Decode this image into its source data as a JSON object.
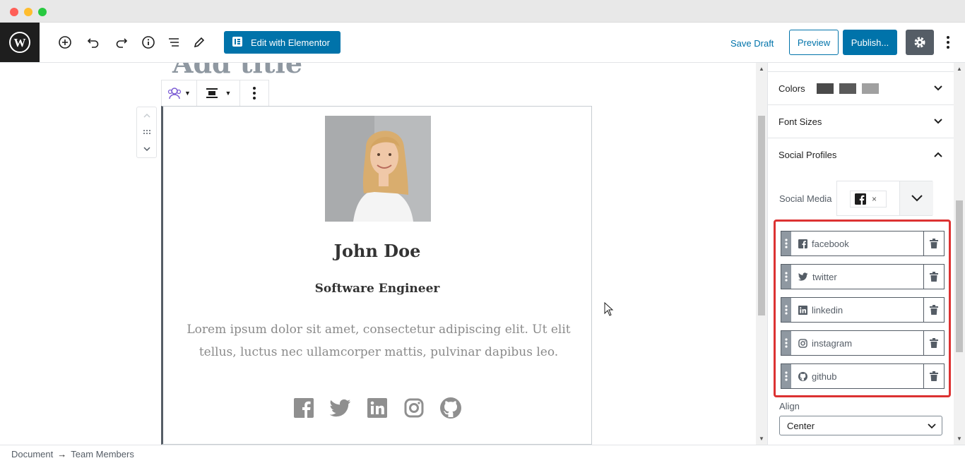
{
  "window": {
    "dots": [
      "#ff5f57",
      "#ffbd2e",
      "#28c940"
    ]
  },
  "toolbar": {
    "icons": [
      "wordpress-logo",
      "plus-icon",
      "undo-icon",
      "redo-icon",
      "info-icon",
      "list-icon",
      "pencil-icon"
    ],
    "elementor_label": "Edit with Elementor",
    "save_draft": "Save Draft",
    "preview": "Preview",
    "publish": "Publish...",
    "accent": "#0073aa"
  },
  "editor": {
    "title_placeholder": "Add title",
    "member": {
      "name": "John Doe",
      "role": "Software Engineer",
      "bio": "Lorem ipsum dolor sit amet, consectetur adipiscing elit. Ut elit tellus, luctus nec ullamcorper mattis, pulvinar dapibus leo.",
      "social_icons": [
        "facebook-icon",
        "twitter-icon",
        "linkedin-icon",
        "instagram-icon",
        "github-icon"
      ]
    }
  },
  "sidebar": {
    "colors_label": "Colors",
    "color_swatches": [
      "#4a4a4a",
      "#5a5a5a",
      "#a0a0a0"
    ],
    "font_sizes_label": "Font Sizes",
    "social_profiles_label": "Social Profiles",
    "social_media_label": "Social Media",
    "chip_remove": "×",
    "profiles": [
      {
        "label": "facebook",
        "icon": "facebook-icon"
      },
      {
        "label": "twitter",
        "icon": "twitter-icon"
      },
      {
        "label": "linkedin",
        "icon": "linkedin-icon"
      },
      {
        "label": "instagram",
        "icon": "instagram-icon"
      },
      {
        "label": "github",
        "icon": "github-icon"
      }
    ],
    "align_label": "Align",
    "align_value": "Center",
    "highlight_color": "#dc3232"
  },
  "footer": {
    "breadcrumb": [
      "Document",
      "→",
      "Team Members"
    ]
  }
}
